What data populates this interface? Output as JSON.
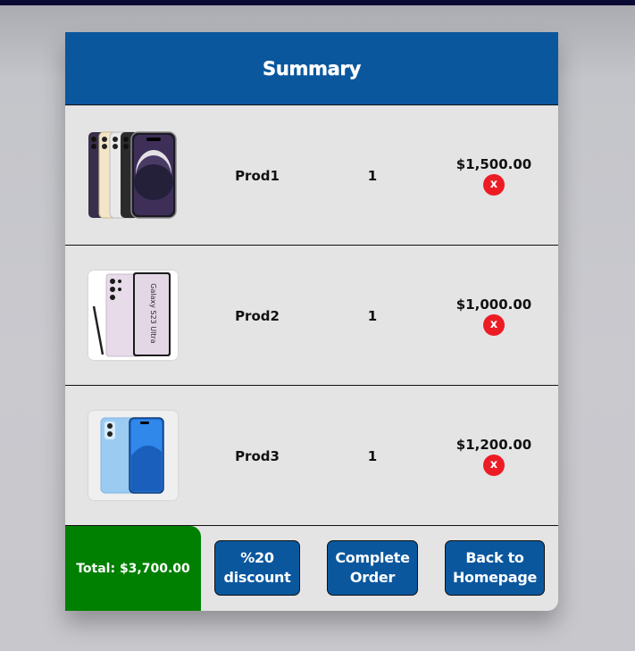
{
  "header": {
    "title": "Summary"
  },
  "cart": {
    "items": [
      {
        "name": "Prod1",
        "quantity": "1",
        "price": "$1,500.00",
        "remove_label": "x",
        "image": "iphone-14-pro-image"
      },
      {
        "name": "Prod2",
        "quantity": "1",
        "price": "$1,000.00",
        "remove_label": "x",
        "image": "galaxy-s23-ultra-image",
        "image_text": "Galaxy S23 Ultra"
      },
      {
        "name": "Prod3",
        "quantity": "1",
        "price": "$1,200.00",
        "remove_label": "x",
        "image": "xiaomi-13-lite-image"
      }
    ]
  },
  "footer": {
    "total": "Total: $3,700.00",
    "discount_line1": "%20",
    "discount_line2": "discount",
    "complete_line1": "Complete",
    "complete_line2": "Order",
    "back_line1": "Back to",
    "back_line2": "Homepage"
  },
  "colors": {
    "header": "#0a579e",
    "card": "#e4e4e5",
    "total": "#008000",
    "remove": "#ec1c24",
    "topbar": "#0b0a35"
  }
}
